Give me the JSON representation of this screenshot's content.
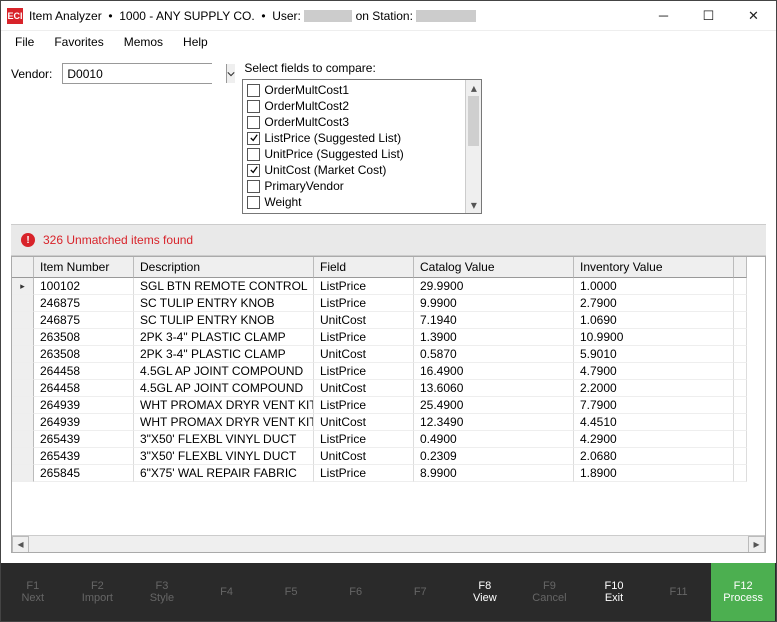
{
  "title": {
    "app_name": "Item Analyzer",
    "company": "1000 - ANY SUPPLY CO.",
    "user_label": "User:",
    "station_label": "on Station:",
    "user_value_masked": true,
    "station_value_masked": true
  },
  "menu": {
    "items": [
      "File",
      "Favorites",
      "Memos",
      "Help"
    ]
  },
  "vendor": {
    "label": "Vendor:",
    "value": "D0010"
  },
  "fields": {
    "label": "Select fields to compare:",
    "items": [
      {
        "label": "OrderMultCost1",
        "checked": false
      },
      {
        "label": "OrderMultCost2",
        "checked": false
      },
      {
        "label": "OrderMultCost3",
        "checked": false
      },
      {
        "label": "ListPrice (Suggested List)",
        "checked": true
      },
      {
        "label": "UnitPrice (Suggested List)",
        "checked": false
      },
      {
        "label": "UnitCost (Market Cost)",
        "checked": true
      },
      {
        "label": "PrimaryVendor",
        "checked": false
      },
      {
        "label": "Weight",
        "checked": false
      }
    ]
  },
  "alert": {
    "text": "326 Unmatched items found"
  },
  "grid": {
    "headers": [
      "Item Number",
      "Description",
      "Field",
      "Catalog Value",
      "Inventory Value"
    ],
    "rows": [
      {
        "sel": true,
        "item": "100102",
        "desc": "SGL BTN REMOTE CONTROL",
        "field": "ListPrice",
        "cat": "29.9900",
        "inv": "1.0000"
      },
      {
        "sel": false,
        "item": "246875",
        "desc": "SC TULIP ENTRY KNOB",
        "field": "ListPrice",
        "cat": "9.9900",
        "inv": "2.7900"
      },
      {
        "sel": false,
        "item": "246875",
        "desc": "SC TULIP ENTRY KNOB",
        "field": "UnitCost",
        "cat": "7.1940",
        "inv": "1.0690"
      },
      {
        "sel": false,
        "item": "263508",
        "desc": "2PK 3-4\" PLASTIC CLAMP",
        "field": "ListPrice",
        "cat": "1.3900",
        "inv": "10.9900"
      },
      {
        "sel": false,
        "item": "263508",
        "desc": "2PK 3-4\" PLASTIC CLAMP",
        "field": "UnitCost",
        "cat": "0.5870",
        "inv": "5.9010"
      },
      {
        "sel": false,
        "item": "264458",
        "desc": "4.5GL AP JOINT COMPOUND",
        "field": "ListPrice",
        "cat": "16.4900",
        "inv": "4.7900"
      },
      {
        "sel": false,
        "item": "264458",
        "desc": "4.5GL AP JOINT COMPOUND",
        "field": "UnitCost",
        "cat": "13.6060",
        "inv": "2.2000"
      },
      {
        "sel": false,
        "item": "264939",
        "desc": "WHT PROMAX DRYR VENT KIT",
        "field": "ListPrice",
        "cat": "25.4900",
        "inv": "7.7900"
      },
      {
        "sel": false,
        "item": "264939",
        "desc": "WHT PROMAX DRYR VENT KIT",
        "field": "UnitCost",
        "cat": "12.3490",
        "inv": "4.4510"
      },
      {
        "sel": false,
        "item": "265439",
        "desc": "3\"X50' FLEXBL VINYL DUCT",
        "field": "ListPrice",
        "cat": "0.4900",
        "inv": "4.2900"
      },
      {
        "sel": false,
        "item": "265439",
        "desc": "3\"X50' FLEXBL VINYL DUCT",
        "field": "UnitCost",
        "cat": "0.2309",
        "inv": "2.0680"
      },
      {
        "sel": false,
        "item": "265845",
        "desc": "6\"X75' WAL REPAIR FABRIC",
        "field": "ListPrice",
        "cat": "8.9900",
        "inv": "1.8900"
      }
    ]
  },
  "footer": {
    "buttons": [
      {
        "fk": "F1",
        "label": "Next",
        "state": "dim"
      },
      {
        "fk": "F2",
        "label": "Import",
        "state": "dim"
      },
      {
        "fk": "F3",
        "label": "Style",
        "state": "dim"
      },
      {
        "fk": "F4",
        "label": "",
        "state": "dim"
      },
      {
        "fk": "F5",
        "label": "",
        "state": "dim"
      },
      {
        "fk": "F6",
        "label": "",
        "state": "dim"
      },
      {
        "fk": "F7",
        "label": "",
        "state": "dim"
      },
      {
        "fk": "F8",
        "label": "View",
        "state": "active"
      },
      {
        "fk": "F9",
        "label": "Cancel",
        "state": "dim"
      },
      {
        "fk": "F10",
        "label": "Exit",
        "state": "active"
      },
      {
        "fk": "F11",
        "label": "",
        "state": "dim"
      },
      {
        "fk": "F12",
        "label": "Process",
        "state": "green"
      }
    ]
  }
}
